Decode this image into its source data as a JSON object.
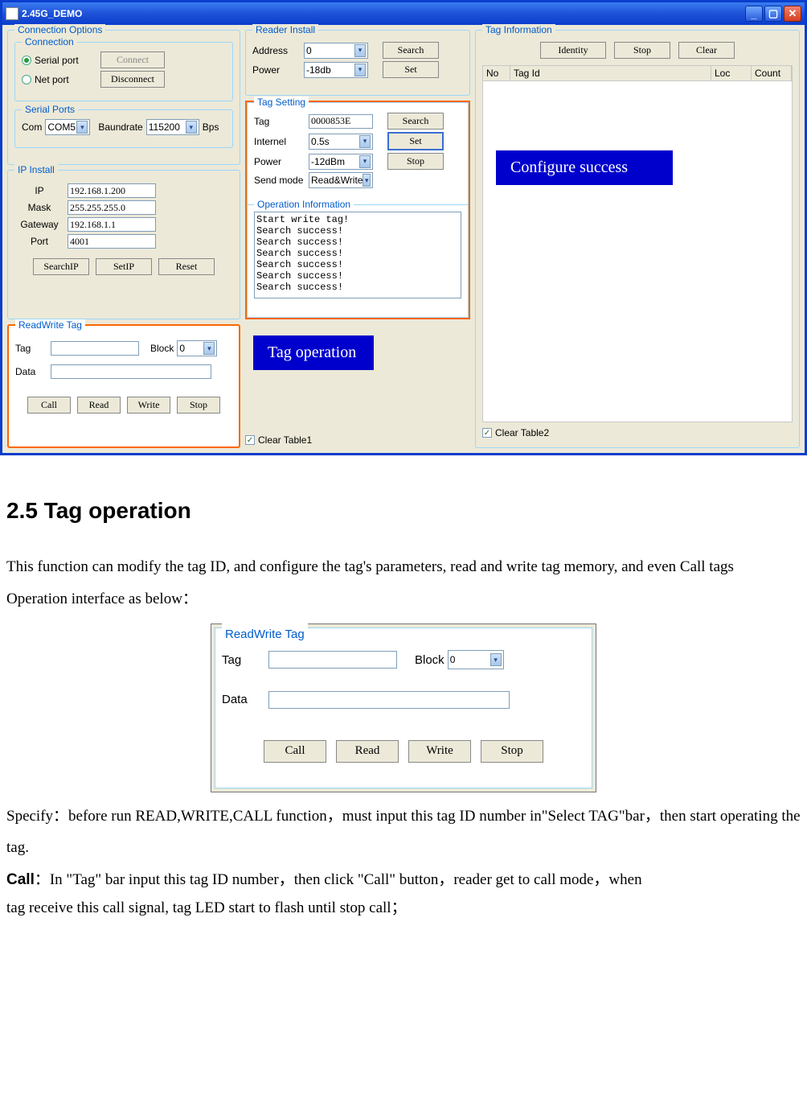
{
  "window": {
    "title": "2.45G_DEMO"
  },
  "connOptions": {
    "title": "Connection Options",
    "connection": {
      "title": "Connection",
      "serial_label": "Serial port",
      "net_label": "Net port",
      "connect_btn": "Connect",
      "disconnect_btn": "Disconnect"
    },
    "serialPorts": {
      "title": "Serial Ports",
      "com_label": "Com",
      "com_value": "COM5",
      "baud_label": "Baundrate",
      "baud_value": "115200",
      "bps_label": "Bps"
    }
  },
  "ipInstall": {
    "title": "IP Install",
    "ip_label": "IP",
    "ip_value": "192.168.1.200",
    "mask_label": "Mask",
    "mask_value": "255.255.255.0",
    "gw_label": "Gateway",
    "gw_value": "192.168.1.1",
    "port_label": "Port",
    "port_value": "4001",
    "searchip_btn": "SearchIP",
    "setip_btn": "SetIP",
    "reset_btn": "Reset"
  },
  "rwTag": {
    "title": "ReadWrite Tag",
    "tag_label": "Tag",
    "tag_value": "",
    "block_label": "Block",
    "block_value": "0",
    "data_label": "Data",
    "data_value": "",
    "call_btn": "Call",
    "read_btn": "Read",
    "write_btn": "Write",
    "stop_btn": "Stop"
  },
  "readerInstall": {
    "title": "Reader Install",
    "addr_label": "Address",
    "addr_value": "0",
    "power_label": "Power",
    "power_value": "-18db",
    "search_btn": "Search",
    "set_btn": "Set"
  },
  "tagSetting": {
    "title": "Tag Setting",
    "tag_label": "Tag",
    "tag_value": "0000853E",
    "internel_label": "Internel",
    "internel_value": "0.5s",
    "power_label": "Power",
    "power_value": "-12dBm",
    "send_label": "Send mode",
    "send_value": "Read&Write",
    "search_btn": "Search",
    "set_btn": "Set",
    "stop_btn": "Stop"
  },
  "opInfo": {
    "title": "Operation Information",
    "text": "Start write tag!\nSearch success!\nSearch success!\nSearch success!\nSearch success!\nSearch success!\nSearch success!"
  },
  "clear1": {
    "label": "Clear Table1"
  },
  "tagInfo": {
    "title": "Tag Information",
    "identity_btn": "Identity",
    "stop_btn": "Stop",
    "clear_btn": "Clear",
    "cols": {
      "no": "No",
      "tagid": "Tag Id",
      "loc": "Loc",
      "count": "Count"
    }
  },
  "clear2": {
    "label": "Clear Table2"
  },
  "callouts": {
    "tag_op": "Tag operation",
    "conf_success": "Configure success"
  },
  "doc": {
    "heading": "2.5   Tag operation",
    "p1": "This function can modify the tag ID, and configure the tag's parameters, read and write tag memory, and even Call tags",
    "p2": "Operation interface as below：",
    "p3": "Specify：before run READ,WRITE,CALL function，must input this tag ID number in\"Select TAG\"bar，then start operating the tag.",
    "p4a": "Call",
    "p4b": "：In \"Tag\" bar input this tag ID number，then click \"Call\" button，reader get to call mode，when",
    "p5": "tag receive this call signal, tag LED start to flash until stop call；"
  },
  "rwTag2": {
    "title": "ReadWrite Tag",
    "tag_label": "Tag",
    "block_label": "Block",
    "block_value": "0",
    "data_label": "Data",
    "call_btn": "Call",
    "read_btn": "Read",
    "write_btn": "Write",
    "stop_btn": "Stop"
  }
}
